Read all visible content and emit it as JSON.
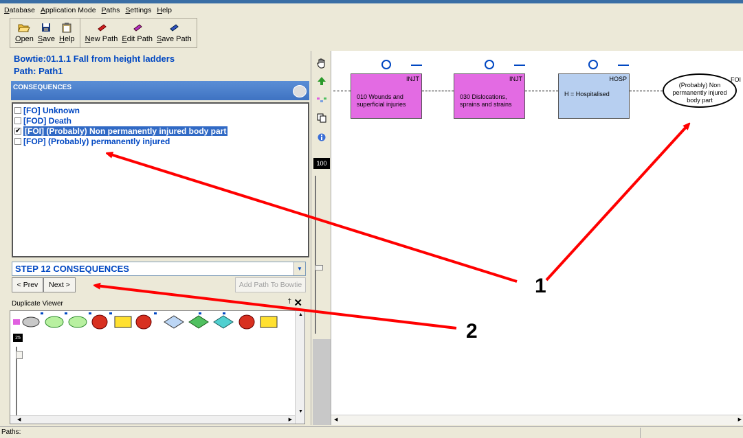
{
  "menu": [
    "Database",
    "Application Mode",
    "Paths",
    "Settings",
    "Help"
  ],
  "toolbar": {
    "open": "Open",
    "save": "Save",
    "help": "Help",
    "new_path": "New Path",
    "edit_path": "Edit Path",
    "save_path": "Save Path"
  },
  "bowtie": {
    "title": "Bowtie:01.1.1 Fall from height ladders",
    "path": "Path:  Path1"
  },
  "consequences": {
    "header": "CONSEQUENCES",
    "items": [
      {
        "label": "[FO] Unknown",
        "checked": false
      },
      {
        "label": "[FOD] Death",
        "checked": false
      },
      {
        "label": "[FOI] (Probably) Non permanently injured body part",
        "checked": true
      },
      {
        "label": "[FOP] (Probably) permanently injured",
        "checked": false
      }
    ]
  },
  "step": {
    "value": "STEP 12 CONSEQUENCES",
    "prev": "< Prev",
    "next": "Next >",
    "add_path": "Add Path To Bowtie"
  },
  "duplicate_viewer": {
    "title": "Duplicate Viewer",
    "pin": "†",
    "close": "✕",
    "zoom": "25"
  },
  "toolcol": {
    "zoom": "100"
  },
  "diagram": {
    "nodes": [
      {
        "code": "INJT",
        "label": "010 Wounds and superficial injuries",
        "color": "#e36be3"
      },
      {
        "code": "INJT",
        "label": "030 Dislocations, sprains and strains",
        "color": "#e36be3"
      },
      {
        "code": "HOSP",
        "label": "H = Hospitalised",
        "color": "#b7cff0"
      }
    ],
    "outcome": {
      "code": "FOI",
      "label": "(Probably) Non permanently injured body part"
    }
  },
  "callouts": {
    "one": "1",
    "two": "2"
  },
  "status": {
    "paths": "Paths:"
  },
  "colors": {
    "arrow": "#ff0000",
    "link_blue": "#0047c2",
    "selection": "#316ac5"
  }
}
